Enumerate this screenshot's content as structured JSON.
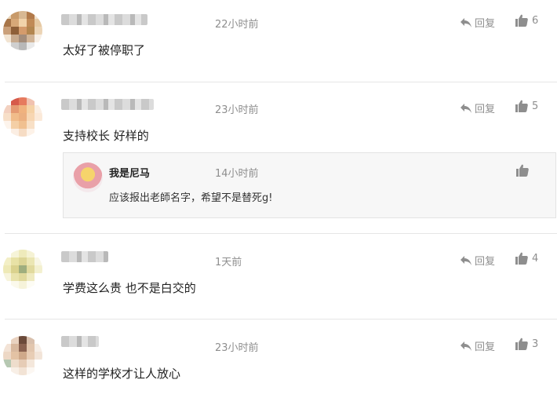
{
  "comments": [
    {
      "time": "22小时前",
      "reply_label": "回复",
      "likes": "6",
      "text": "太好了被停职了"
    },
    {
      "time": "23小时前",
      "reply_label": "回复",
      "likes": "5",
      "text": "支持校长 好样的",
      "reply": {
        "name": "我是尼马",
        "time": "14小时前",
        "text": "应该报出老師名字，希望不是替死g!"
      }
    },
    {
      "time": "1天前",
      "reply_label": "回复",
      "likes": "4",
      "text": "学费这么贵 也不是白交的"
    },
    {
      "time": "23小时前",
      "reply_label": "回复",
      "likes": "3",
      "text": "这样的学校才让人放心"
    }
  ],
  "icons": {
    "reply": "reply-arrow-icon",
    "like": "thumbs-up-icon"
  },
  "colors": {
    "meta": "#8e8e8e",
    "divider": "#e6e6e6",
    "reply_bg": "#f7f7f7"
  }
}
